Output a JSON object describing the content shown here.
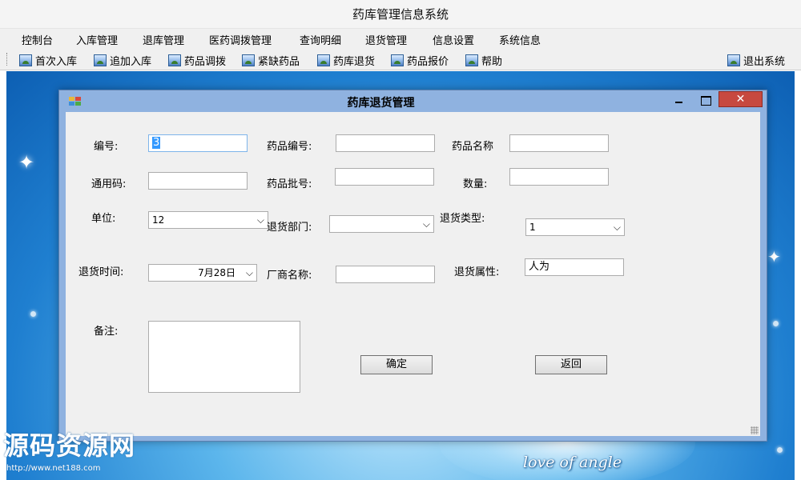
{
  "app": {
    "title": "药库管理信息系统"
  },
  "menu": [
    "控制台",
    "入库管理",
    "退库管理",
    "医药调拨管理",
    "查询明细",
    "退货管理",
    "信息设置",
    "系统信息"
  ],
  "toolbar": {
    "items": [
      "首次入库",
      "追加入库",
      "药品调拨",
      "紧缺药品",
      "药库退货",
      "药品报价",
      "帮助"
    ],
    "exit_label": "退出系统",
    "icon": "picture-icon"
  },
  "dialog": {
    "title": "药库退货管理",
    "close_glyph": "✕",
    "labels": {
      "id": "编号:",
      "drug_code": "药品编号:",
      "drug_name": "药品名称",
      "general_code": "通用码:",
      "batch_no": "药品批号:",
      "quantity": "数量:",
      "unit": "单位:",
      "return_dept": "退货部门:",
      "return_type": "退货类型:",
      "return_time": "退货时间:",
      "vendor": "厂商名称:",
      "return_attr": "退货属性:",
      "remark": "备注:"
    },
    "values": {
      "id": "3",
      "drug_code": "",
      "drug_name": "",
      "general_code": "",
      "batch_no": "",
      "quantity": "",
      "unit": "12",
      "return_dept": "",
      "return_type": "1",
      "return_time": "7月28日",
      "vendor": "",
      "return_attr": "人为",
      "remark": ""
    },
    "buttons": {
      "ok": "确定",
      "back": "返回"
    }
  },
  "desktop": {
    "tagline": "love of angle"
  },
  "watermark": {
    "brand": "源码资源网",
    "url": "http://www.net188.com"
  }
}
